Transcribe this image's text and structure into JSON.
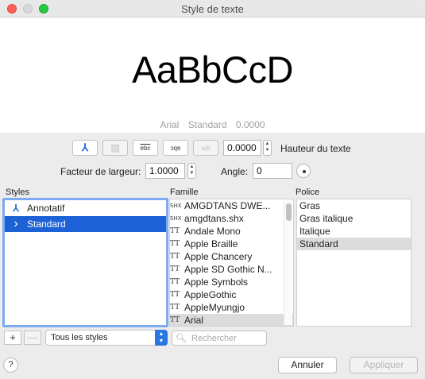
{
  "window": {
    "title": "Style de texte"
  },
  "preview": {
    "sample": "AaBbCcD",
    "font": "Arial",
    "style": "Standard",
    "height": "0.0000"
  },
  "toolbar": {
    "buttons": [
      {
        "icon": "annotative-icon",
        "glyph": "⅄"
      },
      {
        "icon": "background-mask-icon",
        "glyph": "▨"
      },
      {
        "icon": "upside-down-icon",
        "glyph": "ɐbc"
      },
      {
        "icon": "backwards-icon",
        "glyph": "ɔqɐ"
      },
      {
        "icon": "vertical-icon",
        "glyph": "a|b"
      }
    ],
    "height_value": "0.0000",
    "height_label": "Hauteur du texte",
    "width_factor_label": "Facteur de largeur:",
    "width_factor_value": "1.0000",
    "angle_label": "Angle:",
    "angle_value": "0"
  },
  "styles": {
    "title": "Styles",
    "items": [
      {
        "label": "Annotatif",
        "icon": "⅄",
        "selected": false
      },
      {
        "label": "Standard",
        "icon": "›",
        "selected": true
      }
    ],
    "add": "+",
    "remove": "—",
    "filter": "Tous les styles"
  },
  "family": {
    "title": "Famille",
    "items": [
      {
        "icon": "SHX",
        "name": "AMGDTANS DWE..."
      },
      {
        "icon": "SHX",
        "name": "amgdtans.shx"
      },
      {
        "icon": "TT",
        "name": "Andale Mono"
      },
      {
        "icon": "TT",
        "name": "Apple Braille"
      },
      {
        "icon": "TT",
        "name": "Apple Chancery"
      },
      {
        "icon": "TT",
        "name": "Apple SD Gothic N..."
      },
      {
        "icon": "TT",
        "name": "Apple Symbols"
      },
      {
        "icon": "TT",
        "name": "AppleGothic"
      },
      {
        "icon": "TT",
        "name": "AppleMyungjo"
      },
      {
        "icon": "TT",
        "name": "Arial",
        "selected": true
      }
    ],
    "search_placeholder": "Rechercher"
  },
  "police": {
    "title": "Police",
    "items": [
      {
        "label": "Gras"
      },
      {
        "label": "Gras italique"
      },
      {
        "label": "Italique"
      },
      {
        "label": "Standard",
        "selected": true
      }
    ]
  },
  "footer": {
    "help": "?",
    "cancel": "Annuler",
    "apply": "Appliquer"
  }
}
